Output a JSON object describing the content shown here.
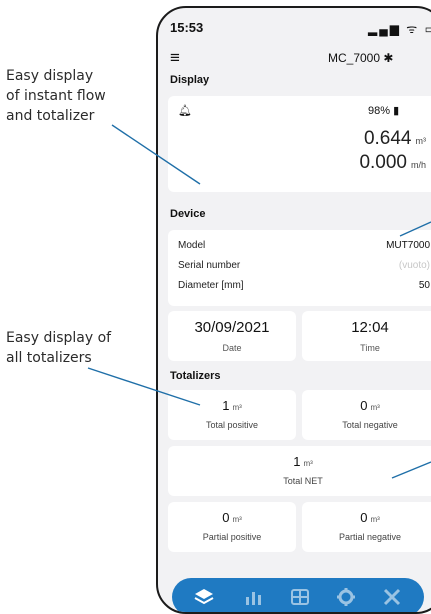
{
  "annotations": {
    "flow": [
      "Easy display",
      "of instant flow",
      "and totalizer"
    ],
    "totalizers": [
      "Easy display of",
      "all totalizers"
    ]
  },
  "status_bar": {
    "time": "15:53",
    "icons": "▂▄▆ ᯤ ▭"
  },
  "app_bar": {
    "menu_icon": "≡",
    "device_name": "MC_7000 ✱"
  },
  "display": {
    "title": "Display",
    "battery": "98% ▮",
    "flow_value": "0.644",
    "flow_unit": "m³",
    "total_value": "0.000",
    "total_unit": "m/h"
  },
  "device": {
    "title": "Device",
    "rows": [
      {
        "label": "Model",
        "value": "MUT7000"
      },
      {
        "label": "Serial number",
        "value": "(vuoto)"
      },
      {
        "label": "Diameter [mm]",
        "value": "50"
      }
    ],
    "date": {
      "value": "30/09/2021",
      "label": "Date"
    },
    "time": {
      "value": "12:04",
      "label": "Time"
    }
  },
  "totalizers": {
    "title": "Totalizers",
    "unit": "m³",
    "positive": {
      "value": "1",
      "label": "Total positive"
    },
    "negative": {
      "value": "0",
      "label": "Total negative"
    },
    "net": {
      "value": "1",
      "label": "Total NET"
    },
    "partial_positive": {
      "value": "0",
      "label": "Partial positive"
    },
    "partial_negative": {
      "value": "0",
      "label": "Partial negative"
    }
  },
  "tabbar": {
    "color": "#1f7ac2",
    "tabs": [
      "layers-icon",
      "bar-chart-icon",
      "grid-icon",
      "gear-icon",
      "tools-icon"
    ]
  }
}
